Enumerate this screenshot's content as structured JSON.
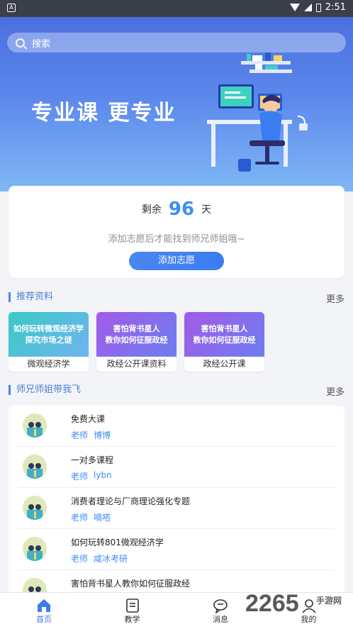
{
  "status_bar": {
    "time": "2:51",
    "left_icon": "A"
  },
  "search": {
    "placeholder": "搜索"
  },
  "hero": {
    "slogan": "专业课  更专业"
  },
  "countdown": {
    "prefix": "剩余",
    "days": "96",
    "suffix": "天",
    "hint": "添加志愿后才能找到师兄师姐哦~",
    "button": "添加志愿"
  },
  "resources": {
    "title": "推荐资料",
    "more": "更多",
    "items": [
      {
        "thumb_line1": "如何玩转微观经济学",
        "thumb_line2": "探究市场之谜",
        "label": "微观经济学",
        "style": "teal"
      },
      {
        "thumb_line1": "害怕背书星人",
        "thumb_line2": "教你如何征服政经",
        "label": "政经公开课资料",
        "style": "purple"
      },
      {
        "thumb_line1": "害怕背书星人",
        "thumb_line2": "教你如何征服政经",
        "label": "政经公开课",
        "style": "purple"
      }
    ]
  },
  "seniors": {
    "title": "师兄师姐带我飞",
    "more": "更多",
    "items": [
      {
        "title": "免费大课",
        "role": "老师",
        "name": "博博"
      },
      {
        "title": "一对多课程",
        "role": "老师",
        "name": "lybn"
      },
      {
        "title": "消费者理论与厂商理论强化专题",
        "role": "老师",
        "name": "嘀嗒"
      },
      {
        "title": "如何玩转801微观经济学",
        "role": "老师",
        "name": "咸冰考研"
      },
      {
        "title": "害怕背书星人教你如何征服政经",
        "role": "",
        "name": ""
      }
    ]
  },
  "tabs": [
    {
      "label": "首页",
      "icon": "home-icon",
      "active": true
    },
    {
      "label": "教学",
      "icon": "book-icon",
      "active": false
    },
    {
      "label": "消息",
      "icon": "message-icon",
      "active": false
    },
    {
      "label": "我的",
      "icon": "user-icon",
      "active": false
    }
  ],
  "watermark": {
    "main": "2265",
    "sub": "手游网"
  },
  "colors": {
    "accent": "#3b7cf0",
    "hero_top": "#4a70e0",
    "hero_bottom": "#7fb8f5"
  }
}
